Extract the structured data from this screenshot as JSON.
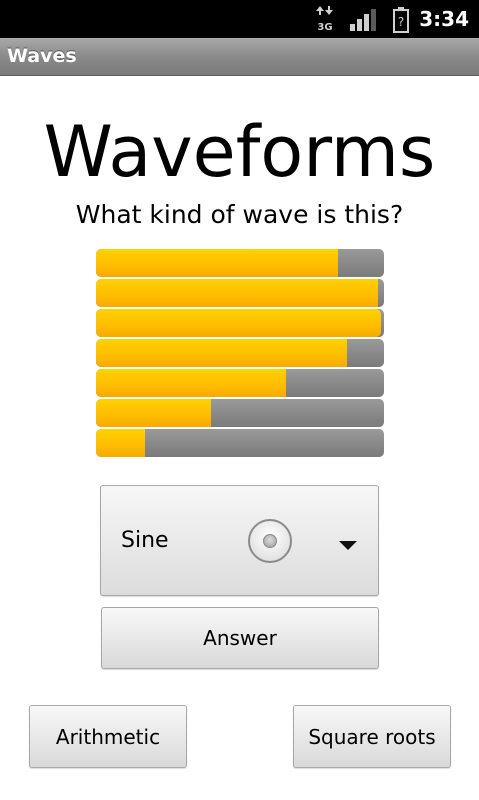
{
  "status_bar": {
    "network_type": "3G",
    "network_icon": "data-arrows-icon",
    "signal_icon": "signal-strength-icon",
    "battery_icon": "battery-unknown-icon",
    "battery_glyph": "?",
    "time": "3:34"
  },
  "title_bar": {
    "app_title": "Waves"
  },
  "main": {
    "heading": "Waveforms",
    "question": "What kind of wave is this?",
    "bars": [
      {
        "level": 0.84
      },
      {
        "level": 0.98
      },
      {
        "level": 0.99
      },
      {
        "level": 0.87
      },
      {
        "level": 0.66
      },
      {
        "level": 0.4
      },
      {
        "level": 0.17
      }
    ],
    "spinner": {
      "selected_value": "Sine"
    },
    "answer_label": "Answer",
    "arithmetic_label": "Arithmetic",
    "square_roots_label": "Square roots"
  },
  "colors": {
    "bar_fill": "#ffbc00",
    "bar_track": "#8a8a8a",
    "title_bar": "#8a8a8a",
    "status_bar": "#000000"
  }
}
